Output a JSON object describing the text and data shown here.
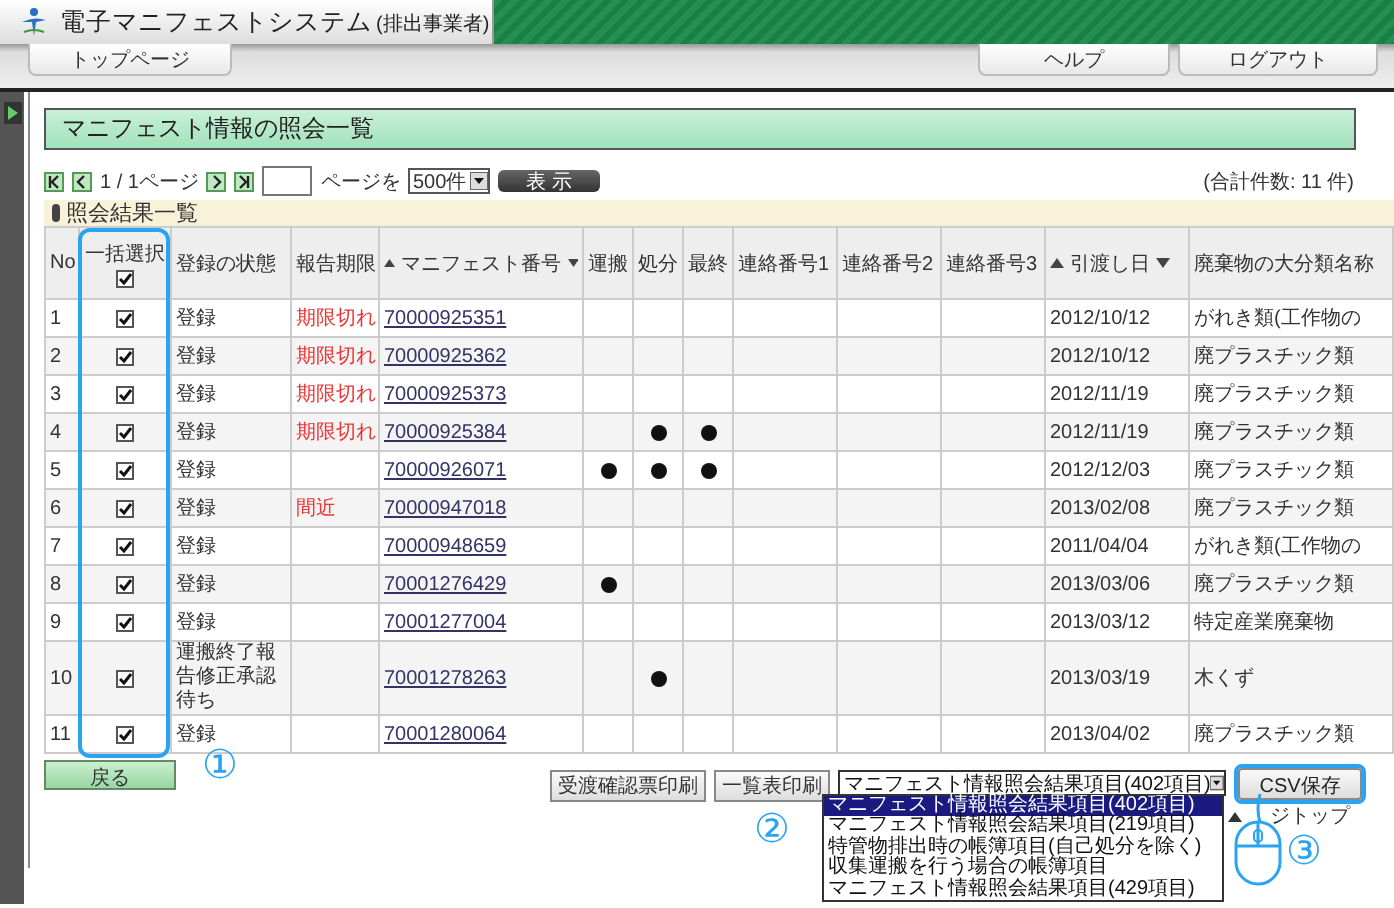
{
  "header": {
    "system_title": "電子マニフェストシステム",
    "subtitle": "(排出事業者)"
  },
  "nav": {
    "left": [
      {
        "label": "トップページ"
      }
    ],
    "right": [
      {
        "label": "ヘルプ"
      },
      {
        "label": "ログアウト"
      }
    ]
  },
  "page_title": "マニフェスト情報の照会一覧",
  "pager": {
    "page_label": "1 / 1ページ",
    "goto_label": "ページを",
    "per_page": "500件",
    "show_button": "表 示",
    "total": "(合計件数: 11 件)"
  },
  "section_title": "照会結果一覧",
  "table": {
    "columns": [
      {
        "label": "No",
        "kind": "text"
      },
      {
        "label": "一括選択",
        "kind": "checkbox",
        "checked": true
      },
      {
        "label": "登録の状態",
        "kind": "text"
      },
      {
        "label": "報告期限",
        "kind": "text"
      },
      {
        "label": "マニフェスト番号",
        "kind": "sort"
      },
      {
        "label": "運搬",
        "kind": "text"
      },
      {
        "label": "処分",
        "kind": "text"
      },
      {
        "label": "最終",
        "kind": "text"
      },
      {
        "label": "連絡番号1",
        "kind": "text"
      },
      {
        "label": "連絡番号2",
        "kind": "text"
      },
      {
        "label": "連絡番号3",
        "kind": "text"
      },
      {
        "label": "引渡し日",
        "kind": "sort"
      },
      {
        "label": "廃棄物の大分類名称",
        "kind": "text"
      }
    ],
    "rows": [
      {
        "no": "1",
        "checked": true,
        "status": "登録",
        "deadline": "期限切れ",
        "manifest_no": "70000925351",
        "transport": false,
        "disposal": false,
        "final": false,
        "date": "2012/10/12",
        "waste": "がれき類(工作物の"
      },
      {
        "no": "2",
        "checked": true,
        "status": "登録",
        "deadline": "期限切れ",
        "manifest_no": "70000925362",
        "transport": false,
        "disposal": false,
        "final": false,
        "date": "2012/10/12",
        "waste": "廃プラスチック類"
      },
      {
        "no": "3",
        "checked": true,
        "status": "登録",
        "deadline": "期限切れ",
        "manifest_no": "70000925373",
        "transport": false,
        "disposal": false,
        "final": false,
        "date": "2012/11/19",
        "waste": "廃プラスチック類"
      },
      {
        "no": "4",
        "checked": true,
        "status": "登録",
        "deadline": "期限切れ",
        "manifest_no": "70000925384",
        "transport": false,
        "disposal": true,
        "final": true,
        "date": "2012/11/19",
        "waste": "廃プラスチック類"
      },
      {
        "no": "5",
        "checked": true,
        "status": "登録",
        "manifest_no": "70000926071",
        "transport": true,
        "disposal": true,
        "final": true,
        "date": "2012/12/03",
        "waste": "廃プラスチック類"
      },
      {
        "no": "6",
        "checked": true,
        "status": "登録",
        "deadline": "間近",
        "manifest_no": "70000947018",
        "transport": false,
        "disposal": false,
        "final": false,
        "date": "2013/02/08",
        "waste": "廃プラスチック類"
      },
      {
        "no": "7",
        "checked": true,
        "status": "登録",
        "manifest_no": "70000948659",
        "transport": false,
        "disposal": false,
        "final": false,
        "date": "2011/04/04",
        "waste": "がれき類(工作物の"
      },
      {
        "no": "8",
        "checked": true,
        "status": "登録",
        "manifest_no": "70001276429",
        "transport": true,
        "disposal": false,
        "final": false,
        "date": "2013/03/06",
        "waste": "廃プラスチック類"
      },
      {
        "no": "9",
        "checked": true,
        "status": "登録",
        "manifest_no": "70001277004",
        "transport": false,
        "disposal": false,
        "final": false,
        "date": "2013/03/12",
        "waste": "特定産業廃棄物"
      },
      {
        "no": "10",
        "checked": true,
        "status": "運搬終了報告修正承認待ち",
        "manifest_no": "70001278263",
        "transport": false,
        "disposal": true,
        "final": false,
        "date": "2013/03/19",
        "waste": "木くず"
      },
      {
        "no": "11",
        "checked": true,
        "status": "登録",
        "manifest_no": "70001280064",
        "transport": false,
        "disposal": false,
        "final": false,
        "date": "2013/04/02",
        "waste": "廃プラスチック類"
      }
    ]
  },
  "footer": {
    "back_button": "戻る",
    "print_buttons": [
      "受渡確認票印刷",
      "一覧表印刷"
    ],
    "export_select": {
      "value": "マニフェスト情報照会結果項目(402項目)",
      "options": [
        {
          "label": "マニフェスト情報照会結果項目(402項目)",
          "selected": true
        },
        {
          "label": "マニフェスト情報照会結果項目(219項目)",
          "selected": false
        },
        {
          "label": "特管物排出時の帳簿項目(自己処分を除く)",
          "selected": false
        },
        {
          "label": "収集運搬を行う場合の帳簿項目",
          "selected": false
        },
        {
          "label": "マニフェスト情報照会結果項目(429項目)",
          "selected": false
        }
      ]
    },
    "csv_button": "CSV保存",
    "page_top": "ジトップ"
  },
  "annotations": [
    "①",
    "②",
    "③"
  ]
}
